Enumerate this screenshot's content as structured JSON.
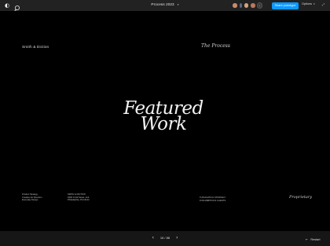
{
  "toolbar": {
    "logo_glyph": "◐",
    "title": "Process 2023",
    "title_caret": "▾",
    "collaborator_count": "+",
    "share_label": "Share prototype",
    "options_label": "Options",
    "options_caret": "▾",
    "expand_glyph": "⤢"
  },
  "slide": {
    "brand": "Smith & Diction",
    "process_tag": "The Process",
    "headline_line1": "Featured",
    "headline_line2": "Work",
    "footer_col1": [
      "Product Strategy",
      "Creative Art Direction",
      "Everyday Design"
    ],
    "footer_col2": [
      "SMITH & DICTION",
      "1800 N 3rd Street, 2nd",
      "Philadelphia, PA 19122"
    ],
    "footer_col3": [
      "THOUGHTFUL STRATEGY",
      "FOR AMBITIOUS CLIENTS"
    ],
    "proprietary": "Proprietary"
  },
  "pager": {
    "prev_glyph": "‹",
    "next_glyph": "›",
    "page_text": "16 / 88"
  },
  "restart": {
    "glyph": "←",
    "label": "Restart"
  },
  "colors": {
    "share_button": "#0d99ff",
    "toolbar_bg": "#222222",
    "slide_bg": "#000000"
  }
}
